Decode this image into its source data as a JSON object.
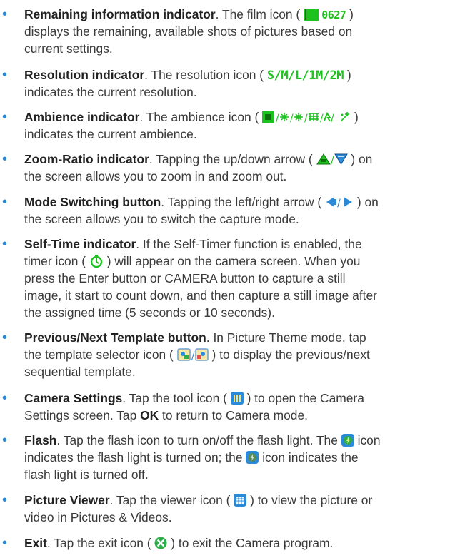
{
  "items": [
    {
      "title": "Remaining information indicator",
      "l1a": ". The film icon (",
      "film_count": "0627",
      "l1b": ")",
      "l2": "displays the remaining, available shots of pictures based on",
      "l3": "current settings."
    },
    {
      "title": "Resolution indicator",
      "l1a": ". The resolution icon (",
      "res_icons": "S/M/L/1M/2M",
      "l1b": ")",
      "l2": "indicates the current resolution."
    },
    {
      "title": "Ambience indicator",
      "l1a": ". The ambience icon (",
      "l1b": ")",
      "l2": "indicates the current ambience."
    },
    {
      "title": "Zoom-Ratio indicator",
      "l1a": ". Tapping the up/down arrow (",
      "l1b": ") on",
      "l2": "the screen allows you to zoom in and zoom out."
    },
    {
      "title": "Mode Switching button",
      "l1a": ". Tapping the left/right arrow (",
      "l1b": ") on",
      "l2": "the screen allows you to switch the capture mode."
    },
    {
      "title": "Self-Time indicator",
      "l1": ". If the Self-Timer function is enabled, the",
      "l2a": "timer icon (",
      "l2b": ") will appear on the camera screen. When you",
      "l3": "press the Enter button or CAMERA button to capture a still",
      "l4": "image, it start to count down, and then capture a still image after",
      "l5": "the assigned time (5 seconds or 10 seconds)."
    },
    {
      "title": "Previous/Next Template button",
      "l1": ". In Picture Theme mode, tap",
      "l2a": "the template selector icon (",
      "l2b": ") to display the previous/next",
      "l3": "sequential template."
    },
    {
      "title": "Camera Settings",
      "l1a": ". Tap the tool icon (",
      "l1b": ") to open the Camera",
      "l2a": "Settings screen. Tap ",
      "ok": "OK",
      "l2b": " to return to Camera mode."
    },
    {
      "title": "Flash",
      "l1a": ". Tap the flash icon to turn on/off the flash light. The",
      "l1b": "icon",
      "l2a": "indicates the flash light is turned on; the",
      "l2b": "icon indicates the",
      "l3": "flash light is turned off."
    },
    {
      "title": "Picture Viewer",
      "l1a": ". Tap the viewer icon (",
      "l1b": ") to view the picture or",
      "l2": "video in Pictures & Videos."
    },
    {
      "title": "Exit",
      "l1a": ". Tap the exit icon (",
      "l1b": ") to exit the Camera program."
    }
  ],
  "bullet": "•",
  "colors": {
    "bullet": "#2f86cf",
    "icon_green": "#1ec21e",
    "icon_blue": "#2a8ad8",
    "exit_green": "#2fae4a"
  }
}
